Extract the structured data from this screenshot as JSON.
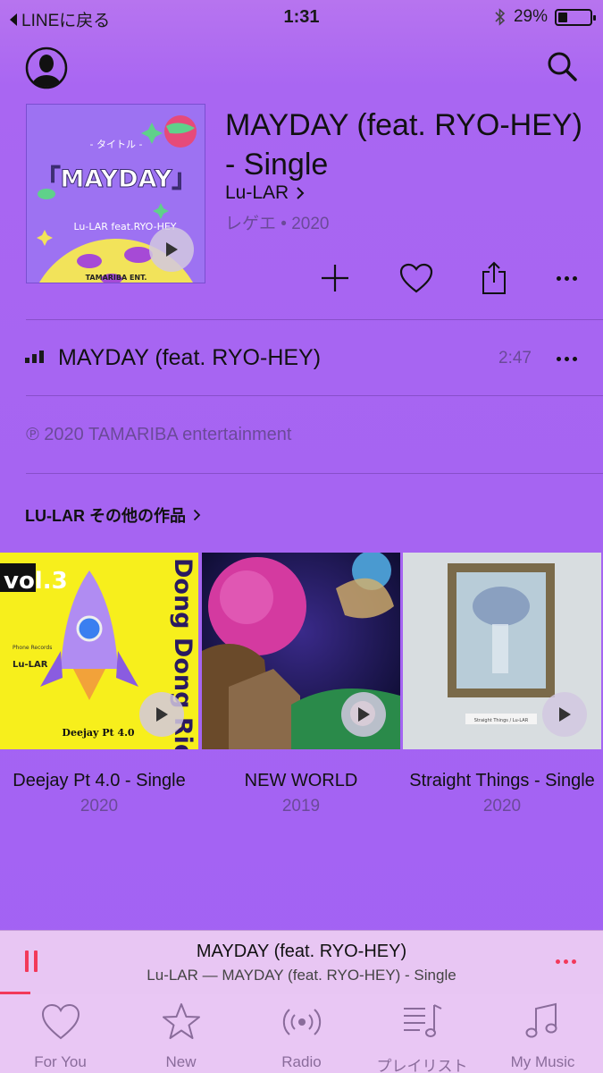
{
  "status_bar": {
    "back_label": "LINEに戻る",
    "time": "1:31",
    "battery_text": "29%",
    "battery_level": 0.29
  },
  "album": {
    "title": "MAYDAY (feat. RYO-HEY) - Single",
    "artist": "Lu-LAR",
    "meta": "レゲエ • 2020",
    "art_text": {
      "sub": "- タイトル -",
      "title": "「MAYDAY」",
      "artist_line": "Lu-LAR feat.RYO-HEY",
      "label": "TAMARIBA ENT."
    }
  },
  "track": {
    "title": "MAYDAY (feat. RYO-HEY)",
    "duration": "2:47"
  },
  "copyright": "℗ 2020 TAMARIBA entertainment",
  "more_section": {
    "title": "LU-LAR その他の作品",
    "albums": [
      {
        "title": "Deejay Pt 4.0 - Single",
        "year": "2020",
        "art_text": {
          "vol": "vol.3",
          "side": "Dong Dong Riddim",
          "label": "Phone Records",
          "artist": "Lu-LAR",
          "caption": "Deejay Pt 4.0"
        }
      },
      {
        "title": "NEW WORLD",
        "year": "2019"
      },
      {
        "title": "Straight Things - Single",
        "year": "2020",
        "art_text": {
          "caption": "Straight Things / Lu-LAR"
        }
      }
    ]
  },
  "mini_player": {
    "title": "MAYDAY (feat. RYO-HEY)",
    "subtitle": "Lu-LAR — MAYDAY (feat. RYO-HEY) - Single",
    "progress": 0.05
  },
  "tabs": [
    {
      "label": "For You",
      "icon": "heart-icon"
    },
    {
      "label": "New",
      "icon": "star-icon"
    },
    {
      "label": "Radio",
      "icon": "radio-icon"
    },
    {
      "label": "プレイリスト",
      "icon": "playlist-icon"
    },
    {
      "label": "My Music",
      "icon": "music-note-icon"
    }
  ],
  "colors": {
    "background": "#a966f2",
    "accent": "#f2395a",
    "secondary_text": "#6b4a99"
  }
}
